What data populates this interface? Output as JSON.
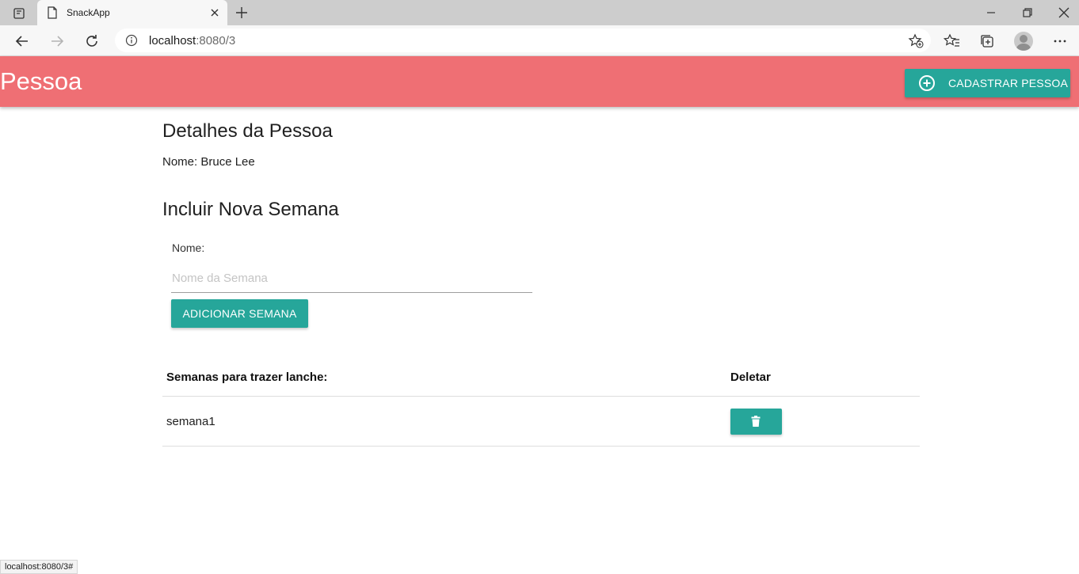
{
  "browser": {
    "tab_title": "SnackApp",
    "url_host": "localhost",
    "url_rest": ":8080/3",
    "status_url": "localhost:8080/3#"
  },
  "header": {
    "title": "Pessoa",
    "cadastrar_label": "CADASTRAR PESSOA"
  },
  "details": {
    "heading": "Detalhes da Pessoa",
    "name_line": "Nome: Bruce Lee"
  },
  "form": {
    "heading": "Incluir Nova Semana",
    "name_label": "Nome:",
    "name_placeholder": "Nome da Semana",
    "name_value": "",
    "submit_label": "ADICIONAR SEMANA"
  },
  "table": {
    "col_weeks": "Semanas para trazer lanche:",
    "col_delete": "Deletar",
    "rows": [
      {
        "week": "semana1"
      }
    ]
  },
  "colors": {
    "header_bg": "#ef6f74",
    "accent": "#26a69a"
  },
  "icons": {
    "header_button": "plus-circle-icon",
    "delete_button": "trash-icon"
  }
}
